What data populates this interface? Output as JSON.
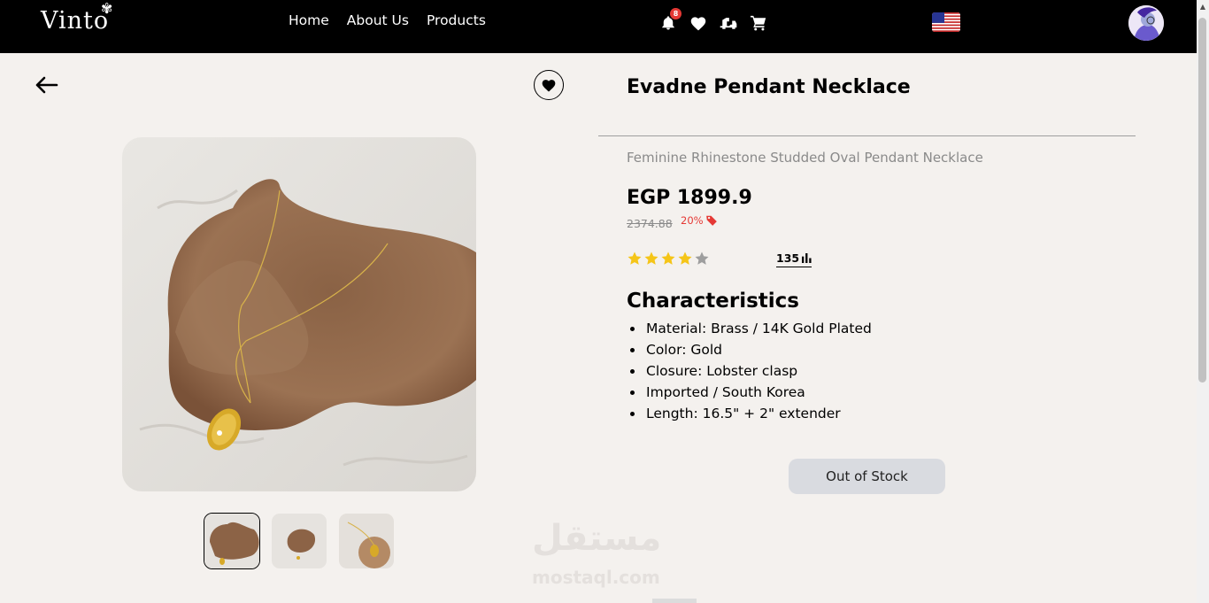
{
  "nav": {
    "logo": "Vinto",
    "links": [
      "Home",
      "About Us",
      "Products"
    ],
    "notification_count": "8"
  },
  "product": {
    "title": "Evadne Pendant Necklace",
    "subtitle": "Feminine Rhinestone Studded Oval Pendant Necklace",
    "price": "EGP 1899.9",
    "old_price": "2374.88",
    "discount": "20%",
    "rating": 4,
    "rating_max": 5,
    "review_count": "135",
    "characteristics_title": "Characteristics",
    "characteristics": [
      "Material: Brass / 14K Gold Plated",
      "Color: Gold",
      "Closure: Lobster clasp",
      "Imported / South Korea",
      "Length: 16.5\" + 2\" extender"
    ],
    "stock_button": "Out of Stock"
  },
  "watermark": {
    "arabic": "مستقل",
    "latin": "mostaql.com"
  },
  "colors": {
    "navbar": "#000000",
    "background": "#f4f1ee",
    "star_filled": "#f5c518",
    "star_empty": "#9e9e9e",
    "discount": "#e53935",
    "button": "#d9dbe0"
  }
}
